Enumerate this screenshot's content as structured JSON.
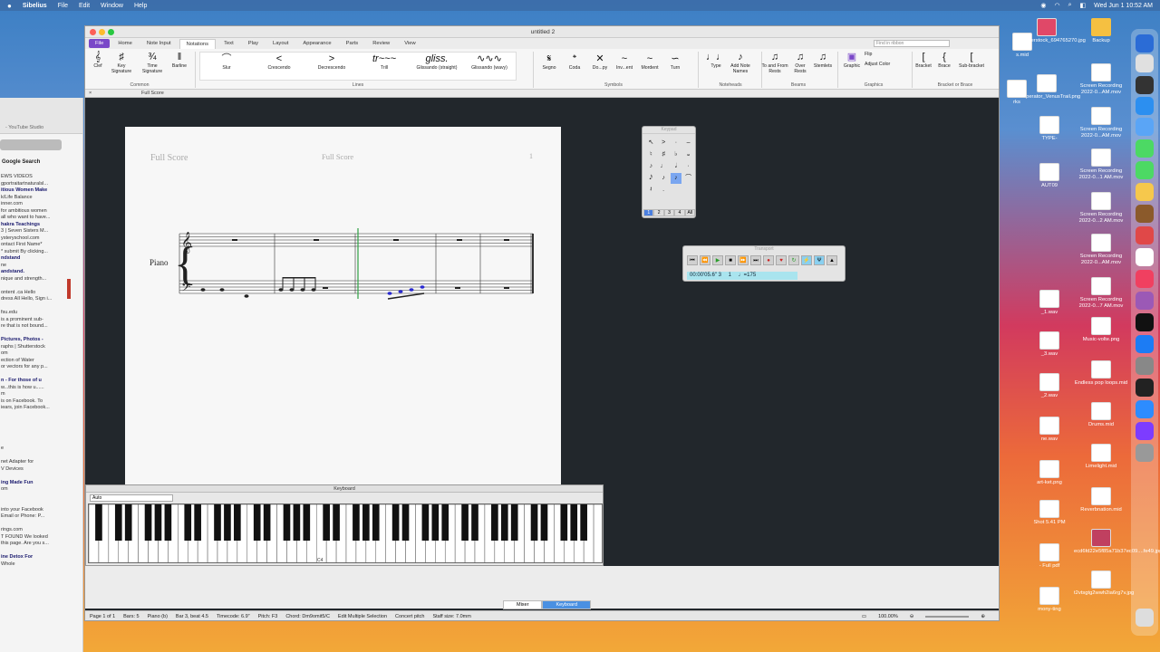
{
  "menubar": {
    "apple": "",
    "app": "Sibelius",
    "items": [
      "File",
      "Edit",
      "Window",
      "Help"
    ],
    "clock": "Wed Jun 1  10:52 AM"
  },
  "browser": {
    "tab_title": "- YouTube Studio",
    "search_label": "Google Search",
    "lines": [
      "EWS VIDEOS",
      "gportraitartnaturalsl...",
      "itious Women Make",
      "k/Life Balance",
      "inner.com",
      "for ambitious women",
      "all who want to have...",
      "hakra Teachings",
      "3 | Seven Sisters M...",
      "ysteryschool.com",
      "ontact First Name*",
      "* submit By clicking...",
      "ndstand",
      "ne",
      "andstand.",
      "nique and strength...",
      "",
      "ontent .ca Hello",
      "dress All Hello, Sign i...",
      "",
      "fsu.edu",
      "is a prominent sub-",
      "re that is not bound...",
      "",
      "Pictures, Photos -",
      "raphs | Shutterstock",
      "om",
      "ection of Water",
      "or vectors for any p...",
      "",
      "n - For those of u",
      "w...this is how u......",
      "m",
      "is on Facebook. To",
      "iears, join Facebook...",
      "",
      "",
      "",
      "",
      "",
      "e",
      "",
      "net Adapter for",
      "V Devices",
      "",
      "ing Made Fun",
      "om",
      "",
      "",
      "into your Facebook",
      "Email or Phone: P...",
      "",
      "rings.com",
      "T FOUND We looked",
      "this page. Are you s...",
      "",
      "ine Detox For",
      "Whole"
    ]
  },
  "sibelius": {
    "title": "untitled 2",
    "tabs": [
      "File",
      "Home",
      "Note Input",
      "Notations",
      "Text",
      "Play",
      "Layout",
      "Appearance",
      "Parts",
      "Review",
      "View"
    ],
    "active_tab": "Notations",
    "search_placeholder": "Find in ribbon",
    "ribbon": {
      "common": {
        "clef": "Clef",
        "key": "Key Signature",
        "time": "Time Signature",
        "barline": "Barline",
        "group": "Common"
      },
      "lines": {
        "items": [
          "Slur",
          "Crescendo",
          "Decrescendo",
          "Trill",
          "Glissando (straight)",
          "Glissando (wavy)"
        ],
        "group": "Lines"
      },
      "symbols": {
        "items": [
          "Segno",
          "Coda",
          "Do...py",
          "Inv...ent",
          "Mordent",
          "Turn"
        ],
        "group": "Symbols"
      },
      "noteheads": {
        "items": [
          "Type",
          "Add Note Names"
        ],
        "group": "Noteheads"
      },
      "beams": {
        "items": [
          "To and From Rests",
          "Over Rests",
          "Stemlets"
        ],
        "group": "Beams"
      },
      "graphics": {
        "items": [
          "Graphic",
          "Flip",
          "Adjust Color"
        ],
        "group": "Graphics"
      },
      "bracket": {
        "items": [
          "Bracket",
          "Brace",
          "Sub-bracket"
        ],
        "group": "Bracket or Brace"
      }
    },
    "doc_tab": "Full Score",
    "score": {
      "header_left": "Full Score",
      "header_center": "Full Score",
      "page_number": "1",
      "instrument": "Piano"
    },
    "keypad": {
      "title": "Keypad",
      "tabs": [
        "1",
        "2",
        "3",
        "4",
        "All"
      ]
    },
    "transport": {
      "title": "Transport",
      "time": "00:00'05.6\" 3",
      "bar": "1",
      "tempo": "♩=175"
    },
    "keyboard": {
      "title": "Keyboard",
      "mode": "Auto",
      "c4_label": "C4"
    },
    "bottom_buttons": [
      "Mixer",
      "Keyboard"
    ],
    "status": {
      "page": "Page 1 of 1",
      "bars": "Bars: 5",
      "inst": "Piano (b)",
      "pos": "Bar 3, beat 4.5",
      "timecode": "Timecode: 6.9\"",
      "pitch": "Pitch: F3",
      "chord": "Chord: Dm9omit5/C",
      "mode": "Edit Multiple Selection",
      "concert": "Concert pitch",
      "staff": "Staff size: 7.0mm",
      "zoom": "100.00%"
    }
  },
  "desktop": [
    {
      "label": "s.mid"
    },
    {
      "label": "shutterstock_694765270.jpg"
    },
    {
      "label": "Backup"
    },
    {
      "label": "Seperator_VenusTrail.png"
    },
    {
      "label": "Screen Recording 2022-0...AM.mov"
    },
    {
      "label": "Screen Recording 2022-0...AM.mov"
    },
    {
      "label": "Screen Recording 2022-0...1 AM.mov"
    },
    {
      "label": "Screen Recording 2022-0...2 AM.mov"
    },
    {
      "label": "Screen Recording 2022-0...AM.mov"
    },
    {
      "label": "Screen Recording 2022-0...7 AM.mov"
    },
    {
      "label": "Music-volte.png"
    },
    {
      "label": "Endless pop loops.mid"
    },
    {
      "label": "Drums.mid"
    },
    {
      "label": "Limelight.mid"
    },
    {
      "label": "Reverbnation.mid"
    },
    {
      "label": "ecd6fd22e5f85a71b37ec09....fe49.jpg"
    },
    {
      "label": "t2vtsgtg2wwh2ia6rg7v.jpg"
    },
    {
      "label": "rks"
    },
    {
      "label": "TYPE-"
    },
    {
      "label": "AUT09"
    },
    {
      "label": "_1.wav"
    },
    {
      "label": "_3.wav"
    },
    {
      "label": "_2.wav"
    },
    {
      "label": "ne.wav"
    },
    {
      "label": "art-ket.png"
    },
    {
      "label": "Shot 5.41 PM"
    },
    {
      "label": "- Full pdf"
    },
    {
      "label": "mony-ting"
    }
  ]
}
